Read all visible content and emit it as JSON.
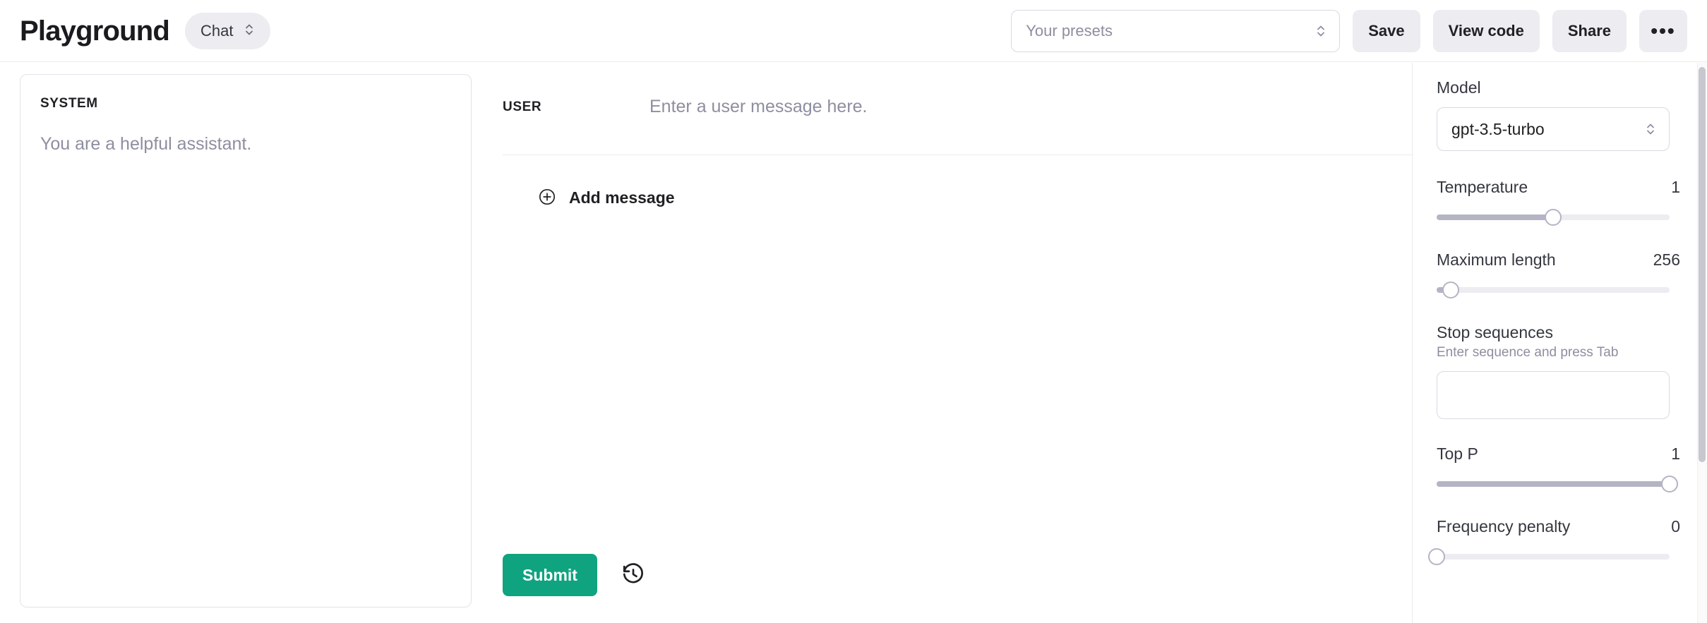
{
  "header": {
    "title": "Playground",
    "mode": {
      "label": "Chat",
      "icon": "chevron-up-down-icon"
    },
    "presets": {
      "placeholder": "Your presets",
      "value": "",
      "icon": "chevron-up-down-icon"
    },
    "actions": [
      {
        "id": "save",
        "label": "Save"
      },
      {
        "id": "view-code",
        "label": "View code"
      },
      {
        "id": "share",
        "label": "Share"
      },
      {
        "id": "more",
        "label": "•••"
      }
    ]
  },
  "system": {
    "label": "SYSTEM",
    "placeholder": "You are a helpful assistant.",
    "value": ""
  },
  "conversation": {
    "messages": [
      {
        "role": "USER",
        "placeholder": "Enter a user message here.",
        "value": ""
      }
    ],
    "add_message": {
      "label": "Add message",
      "icon": "plus-circle-icon"
    }
  },
  "footer": {
    "submit_label": "Submit",
    "history_icon": "history-clock-icon"
  },
  "parameters": {
    "model": {
      "label": "Model",
      "value": "gpt-3.5-turbo",
      "icon": "chevron-up-down-icon"
    },
    "temperature": {
      "label": "Temperature",
      "value": "1",
      "percent": 50
    },
    "maximum_length": {
      "label": "Maximum length",
      "value": "256",
      "percent": 6
    },
    "stop_sequences": {
      "label": "Stop sequences",
      "hint": "Enter sequence and press Tab",
      "value": ""
    },
    "top_p": {
      "label": "Top P",
      "value": "1",
      "percent": 100
    },
    "frequency_penalty": {
      "label": "Frequency penalty",
      "value": "0",
      "percent": 0
    }
  },
  "colors": {
    "accent_green": "#10a37f",
    "button_gray": "#ececf1",
    "border": "#d9d9e3",
    "muted_text": "#8e8ea0",
    "text": "#202123"
  }
}
